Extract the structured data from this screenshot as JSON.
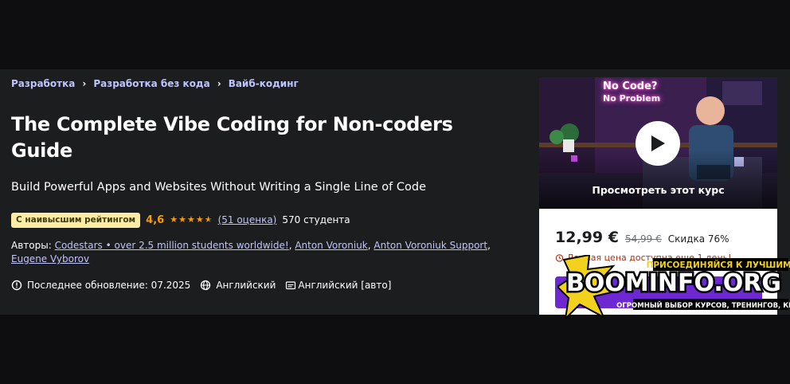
{
  "breadcrumb": {
    "items": [
      "Разработка",
      "Разработка без кода",
      "Вайб-кодинг"
    ],
    "separator": "›"
  },
  "course": {
    "title": "The Complete Vibe Coding for Non-coders Guide",
    "subtitle": "Build Powerful Apps and Websites Without Writing a Single Line of Code"
  },
  "rating": {
    "badge": "С наивысшим рейтингом",
    "value": "4,6",
    "stars_out_of_5": 4.6,
    "count_link": "(51 оценка)",
    "students": "570 студента"
  },
  "authors": {
    "label": "Авторы:",
    "names": [
      "Codestars • over 2.5 million students worldwide!",
      "Anton Voroniuk",
      "Anton Voroniuk Support",
      "Eugene Vyborov"
    ]
  },
  "meta": {
    "updated": "Последнее обновление: 07.2025",
    "language": "Английский",
    "captions": "Английский [авто]"
  },
  "card": {
    "preview_sign_line1": "No Code?",
    "preview_sign_line2": "No Problem",
    "preview_label": "Просмотреть этот курс",
    "price_now": "12,99 €",
    "price_old": "54,99 €",
    "discount": "Скидка 76%",
    "timer_text": "Данная цена доступна еще 1 день!"
  },
  "watermark": {
    "top": "ПРИСОЕДИНЯЙСЯ К ЛУЧШИМ!",
    "main": "BOOMINFO.ORG",
    "bottom": "ОГРОМНЫЙ ВЫБОР КУРСОВ, ТРЕНИНГОВ, КНИГ"
  },
  "colors": {
    "background": "#1c1d1f",
    "link": "#c0c4fc",
    "rating": "#f69c08",
    "badge_bg": "#fceca6",
    "cta": "#6d28d2"
  }
}
